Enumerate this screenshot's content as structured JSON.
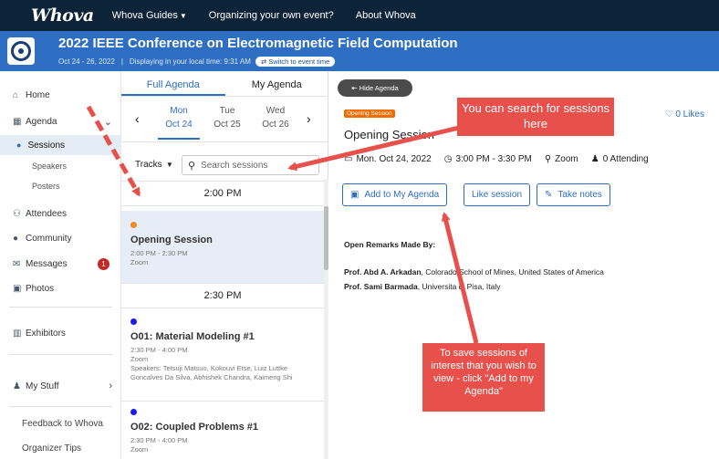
{
  "topnav": {
    "logo": "Whova",
    "items": [
      "Whova Guides",
      "Organizing your own event?",
      "About Whova"
    ]
  },
  "banner": {
    "title": "2022 IEEE Conference on Electromagnetic Field Computation",
    "dates": "Oct 24 - 26, 2022",
    "local_time": "Displaying in your local time: 9:31 AM",
    "switch_label": "Switch to event time"
  },
  "sidebar": {
    "home": "Home",
    "agenda": "Agenda",
    "sessions": "Sessions",
    "speakers": "Speakers",
    "posters": "Posters",
    "attendees": "Attendees",
    "community": "Community",
    "messages": "Messages",
    "messages_badge": "1",
    "photos": "Photos",
    "exhibitors": "Exhibitors",
    "my_stuff": "My Stuff",
    "feedback": "Feedback to Whova",
    "organizer_tips": "Organizer Tips"
  },
  "agenda": {
    "tabs": [
      "Full Agenda",
      "My Agenda"
    ],
    "days": [
      {
        "dow": "Mon",
        "date": "Oct 24"
      },
      {
        "dow": "Tue",
        "date": "Oct 25"
      },
      {
        "dow": "Wed",
        "date": "Oct 26"
      }
    ],
    "tracks_label": "Tracks",
    "search_placeholder": "Search sessions",
    "time1": "2:00 PM",
    "time2": "2:30 PM",
    "sessions": [
      {
        "title": "Opening Session",
        "time": "2:00 PM - 2:30 PM",
        "location": "Zoom",
        "speakers": "",
        "dot": "#f08c1e"
      },
      {
        "title": "O01: Material Modeling #1",
        "time": "2:30 PM - 4:00 PM",
        "location": "Zoom",
        "speakers": "Speakers: Tetsuji Matsuo, Kokouvi Etse, Luiz Luttke Goncalves Da Silva, Abhishek Chandra, Kaimeng Shi",
        "dot": "#1a1aee"
      },
      {
        "title": "O02: Coupled Problems #1",
        "time": "2:30 PM - 4:00 PM",
        "location": "Zoom",
        "speakers": "",
        "dot": "#1a1aee"
      }
    ]
  },
  "detail": {
    "hide_label": "Hide Agenda",
    "tag": "Opening Session",
    "likes": "0 Likes",
    "title": "Opening Session",
    "date": "Mon. Oct 24, 2022",
    "time": "3:00 PM - 3:30 PM",
    "location": "Zoom",
    "attending": "0 Attending",
    "add_label": "Add to My Agenda",
    "like_label": "Like session",
    "notes_label": "Take notes",
    "desc_heading": "Open Remarks Made By:",
    "speaker1_name": "Prof. Abd A. Arkadan",
    "speaker1_affil": ", Colorado School of Mines, United States of America",
    "speaker2_name": "Prof. Sami Barmada",
    "speaker2_affil": ", Universita di Pisa, Italy"
  },
  "annotations": {
    "callout1": "You can search for sessions here",
    "callout2": "To save sessions of interest that you wish to view  - click \"Add to my Agenda\""
  },
  "colors": {
    "nav_bg": "#0d2438",
    "banner_bg": "#2f6fc3",
    "accent": "#2f6fc3",
    "tag_orange": "#ef6c00",
    "annotation_red": "#e8504b"
  }
}
